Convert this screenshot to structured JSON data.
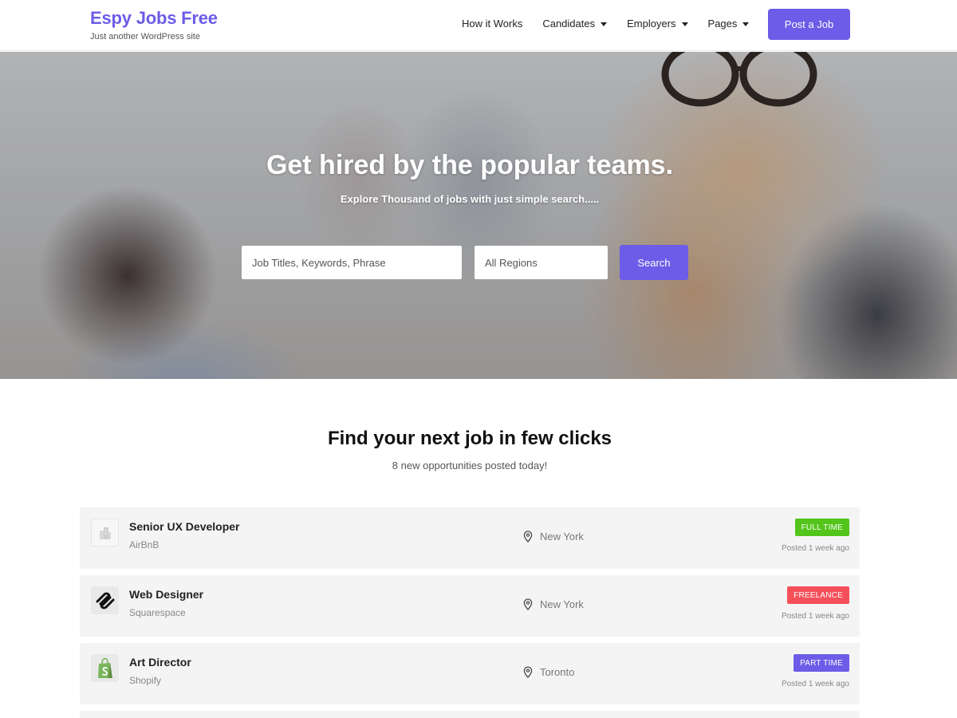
{
  "header": {
    "brand_title": "Espy Jobs Free",
    "brand_tagline": "Just another WordPress site",
    "nav": [
      {
        "label": "How it Works",
        "has_dropdown": false
      },
      {
        "label": "Candidates",
        "has_dropdown": true
      },
      {
        "label": "Employers",
        "has_dropdown": true
      },
      {
        "label": "Pages",
        "has_dropdown": true
      }
    ],
    "post_job_label": "Post a Job",
    "accent_color": "#6c5ce7"
  },
  "hero": {
    "title": "Get hired by the popular teams.",
    "subtitle": "Explore Thousand of jobs with just simple search.....",
    "search_placeholder": "Job Titles, Keywords, Phrase",
    "region_value": "All Regions",
    "search_button": "Search"
  },
  "jobs_section": {
    "title": "Find your next job in few clicks",
    "subtitle": "8 new opportunities posted today!",
    "jobs": [
      {
        "title": "Senior UX Developer",
        "company": "AirBnB",
        "location": "New York",
        "type": "FULL TIME",
        "type_color": "#52c41a",
        "posted": "Posted 1 week ago",
        "logo_icon": "building-placeholder-icon"
      },
      {
        "title": "Web Designer",
        "company": "Squarespace",
        "location": "New York",
        "type": "FREELANCE",
        "type_color": "#f5505a",
        "posted": "Posted 1 week ago",
        "logo_icon": "squarespace-logo-icon"
      },
      {
        "title": "Art Director",
        "company": "Shopify",
        "location": "Toronto",
        "type": "PART TIME",
        "type_color": "#6c5ce7",
        "posted": "Posted 1 week ago",
        "logo_icon": "shopify-logo-icon"
      }
    ]
  }
}
